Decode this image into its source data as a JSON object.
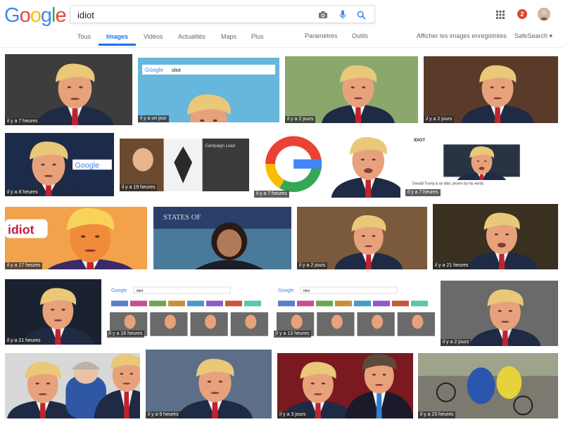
{
  "logo": {
    "text": "Google",
    "letters": [
      "G",
      "o",
      "o",
      "g",
      "l",
      "e"
    ],
    "colors": [
      "#4285F4",
      "#EA4335",
      "#FBBC05",
      "#4285F4",
      "#34A853",
      "#EA4335"
    ]
  },
  "search": {
    "query": "idiot"
  },
  "header": {
    "notification_count": "2"
  },
  "tabs": [
    {
      "label": "Tous",
      "active": false
    },
    {
      "label": "Images",
      "active": true
    },
    {
      "label": "Vidéos",
      "active": false
    },
    {
      "label": "Actualités",
      "active": false
    },
    {
      "label": "Maps",
      "active": false
    },
    {
      "label": "Plus",
      "active": false
    }
  ],
  "tools": {
    "settings": "Paramètres",
    "tools": "Outils",
    "saved": "Afficher les images enregistrées",
    "safesearch": "SafeSearch ▾"
  },
  "tiles": [
    {
      "caption": "il y a 7 heures",
      "scene": "portrait",
      "bg": "#3d3d3d"
    },
    {
      "caption": "il y a un jour",
      "scene": "searchbar",
      "bg": "#67b7dc",
      "query": "idiot"
    },
    {
      "caption": "il y a 2 jours",
      "scene": "portrait",
      "bg": "#8aa86b"
    },
    {
      "caption": "il y a 2 jours",
      "scene": "portrait",
      "bg": "#5a3b2a"
    },
    {
      "caption": "il y a 8 heures",
      "scene": "portrait-logo",
      "bg": "#1d2b4a",
      "logo": "Google"
    },
    {
      "caption": "il y a 19 heures",
      "scene": "collage",
      "bg": "#2c2c2c",
      "title": "Campaign Lead"
    },
    {
      "caption": "il y a 7 heures",
      "scene": "g-logo",
      "bg": "#ffffff"
    },
    {
      "caption": "il y a 7 heures",
      "scene": "article",
      "bg": "#ffffff",
      "tag": "IDIOT",
      "headline": "Donald Trump is an idiot, proven by his words"
    },
    {
      "caption": "il y a 17 heures",
      "scene": "popart",
      "bg": "#f2a24b",
      "text": "idiot"
    },
    {
      "caption": "",
      "scene": "woman",
      "bg": "#4a7a9a",
      "banner": "STATES OF"
    },
    {
      "caption": "il y a 2 jours",
      "scene": "portrait",
      "bg": "#7a5a3a"
    },
    {
      "caption": "il y a 21 heures",
      "scene": "portrait",
      "bg": "#3a3020"
    },
    {
      "caption": "il y a 21 heures",
      "scene": "portrait",
      "bg": "#1a2230"
    },
    {
      "caption": "il y a 16 heures",
      "scene": "results",
      "bg": "#ffffff",
      "query": "idiot"
    },
    {
      "caption": "il y a 13 heures",
      "scene": "results",
      "bg": "#ffffff",
      "query": "idiot"
    },
    {
      "caption": "il y a 2 jours",
      "scene": "portrait",
      "bg": "#6a6a6a"
    },
    {
      "caption": "",
      "scene": "pair",
      "bg": "#d8d8d8"
    },
    {
      "caption": "il y a 9 heures",
      "scene": "portrait",
      "bg": "#5d6f88"
    },
    {
      "caption": "il y a 3 jours",
      "scene": "pair-dark",
      "bg": "#7a1a20"
    },
    {
      "caption": "il y a 23 heures",
      "scene": "cycling",
      "bg": "#8a8a78"
    }
  ]
}
